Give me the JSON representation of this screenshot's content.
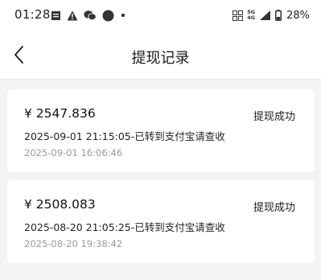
{
  "status_bar": {
    "time": "01:28",
    "network": "5G",
    "network_sub": "4G",
    "battery": "28%"
  },
  "header": {
    "title": "提现记录"
  },
  "records": [
    {
      "amount": "¥ 2547.836",
      "status": "提现成功",
      "detail": "2025-09-01 21:15:05-已转到支付宝请查收",
      "created": "2025-09-01 16:06:46"
    },
    {
      "amount": "¥ 2508.083",
      "status": "提现成功",
      "detail": "2025-08-20 21:05:25-已转到支付宝请查收",
      "created": "2025-08-20 19:38:42"
    }
  ],
  "colors": {
    "background": "#f4f4f4",
    "card": "#ffffff",
    "secondary_text": "#9a9a9a"
  }
}
